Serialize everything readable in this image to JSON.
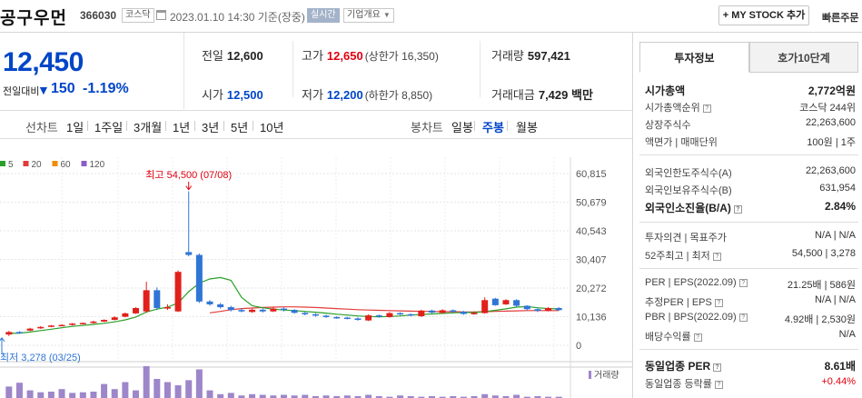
{
  "header": {
    "stock_name": "공구우먼",
    "stock_code": "366030",
    "market": "코스닥",
    "datetime": "2023.01.10 14:30 기준(장중)",
    "realtime": "실시간",
    "company_overview": "기업개요",
    "mystock_button": "+ MY STOCK 추가",
    "quick_order": "빠른주문"
  },
  "price": {
    "current": "12,450",
    "change_label": "전일대비",
    "change_amount": "150",
    "change_rate": "-1.19%"
  },
  "stats": {
    "prev_close_label": "전일",
    "prev_close": "12,600",
    "high_label": "고가",
    "high": "12,650",
    "upper_limit": "(상한가 16,350)",
    "volume_label": "거래량",
    "volume": "597,421",
    "open_label": "시가",
    "open": "12,500",
    "low_label": "저가",
    "low": "12,200",
    "lower_limit": "(하한가 8,850)",
    "amount_label": "거래대금",
    "amount": "7,429 백만"
  },
  "tabs": {
    "line_chart": "선차트",
    "periods": [
      "1일",
      "1주일",
      "3개월",
      "1년",
      "3년",
      "5년",
      "10년"
    ],
    "candle_chart": "봉차트",
    "candle_types": [
      "일봉",
      "주봉",
      "월봉"
    ],
    "active_candle": "주봉"
  },
  "chart_data": {
    "type": "candlestick",
    "legend": [
      {
        "name": "5",
        "color": "#2aa02a"
      },
      {
        "name": "20",
        "color": "#e23b3b"
      },
      {
        "name": "60",
        "color": "#f28c00"
      },
      {
        "name": "120",
        "color": "#8a5cc7"
      }
    ],
    "y_ticks": [
      "60,815",
      "50,679",
      "40,543",
      "30,407",
      "20,272",
      "10,136",
      "0"
    ],
    "ylim": [
      0,
      60815
    ],
    "high_annotation": "최고 54,500 (07/08)",
    "low_annotation": "최저 3,278 (03/25)",
    "volume_label": "거래량",
    "candles": [
      {
        "o": 3800,
        "c": 4700,
        "h": 5100,
        "l": 3278
      },
      {
        "o": 4700,
        "c": 4300,
        "h": 5000,
        "l": 4100
      },
      {
        "o": 5200,
        "c": 5900,
        "h": 6200,
        "l": 5000
      },
      {
        "o": 6000,
        "c": 6500,
        "h": 6800,
        "l": 5800
      },
      {
        "o": 6600,
        "c": 7000,
        "h": 7200,
        "l": 6400
      },
      {
        "o": 7000,
        "c": 7200,
        "h": 7500,
        "l": 6800
      },
      {
        "o": 7200,
        "c": 7700,
        "h": 7900,
        "l": 7000
      },
      {
        "o": 7700,
        "c": 7900,
        "h": 8100,
        "l": 7500
      },
      {
        "o": 7900,
        "c": 8400,
        "h": 8700,
        "l": 7700
      },
      {
        "o": 8400,
        "c": 9000,
        "h": 9200,
        "l": 8200
      },
      {
        "o": 9000,
        "c": 9900,
        "h": 10300,
        "l": 8800
      },
      {
        "o": 10100,
        "c": 11300,
        "h": 11600,
        "l": 9900
      },
      {
        "o": 11300,
        "c": 13200,
        "h": 13500,
        "l": 11100
      },
      {
        "o": 12000,
        "c": 19500,
        "h": 22500,
        "l": 11500
      },
      {
        "o": 19500,
        "c": 13200,
        "h": 20500,
        "l": 12500
      },
      {
        "o": 13000,
        "c": 13500,
        "h": 14500,
        "l": 12500
      },
      {
        "o": 12000,
        "c": 26000,
        "h": 26500,
        "l": 11800
      },
      {
        "o": 33000,
        "c": 32000,
        "h": 54500,
        "l": 31500
      },
      {
        "o": 32000,
        "c": 15500,
        "h": 32500,
        "l": 15000
      },
      {
        "o": 15500,
        "c": 14500,
        "h": 16000,
        "l": 14000
      },
      {
        "o": 14500,
        "c": 13500,
        "h": 15000,
        "l": 13000
      },
      {
        "o": 13500,
        "c": 12500,
        "h": 14000,
        "l": 12000
      },
      {
        "o": 12500,
        "c": 12000,
        "h": 13200,
        "l": 11700
      },
      {
        "o": 11800,
        "c": 12600,
        "h": 13000,
        "l": 11500
      },
      {
        "o": 12600,
        "c": 12000,
        "h": 13100,
        "l": 11600
      },
      {
        "o": 12000,
        "c": 13000,
        "h": 13500,
        "l": 11800
      },
      {
        "o": 13000,
        "c": 12500,
        "h": 13400,
        "l": 12000
      },
      {
        "o": 12500,
        "c": 11500,
        "h": 12800,
        "l": 11200
      },
      {
        "o": 11500,
        "c": 11000,
        "h": 11800,
        "l": 10600
      },
      {
        "o": 11000,
        "c": 10500,
        "h": 11300,
        "l": 10100
      },
      {
        "o": 10500,
        "c": 10000,
        "h": 10800,
        "l": 9700
      },
      {
        "o": 10000,
        "c": 9800,
        "h": 10300,
        "l": 9400
      },
      {
        "o": 9800,
        "c": 9500,
        "h": 10100,
        "l": 9200
      },
      {
        "o": 9500,
        "c": 9000,
        "h": 9900,
        "l": 8700
      },
      {
        "o": 8800,
        "c": 10600,
        "h": 11000,
        "l": 8600
      },
      {
        "o": 10600,
        "c": 10100,
        "h": 10900,
        "l": 9800
      },
      {
        "o": 10000,
        "c": 11400,
        "h": 11800,
        "l": 9800
      },
      {
        "o": 11400,
        "c": 11000,
        "h": 11700,
        "l": 10700
      },
      {
        "o": 11000,
        "c": 10600,
        "h": 11300,
        "l": 10300
      },
      {
        "o": 10300,
        "c": 12300,
        "h": 12600,
        "l": 10000
      },
      {
        "o": 12300,
        "c": 11600,
        "h": 12600,
        "l": 11200
      },
      {
        "o": 11500,
        "c": 12400,
        "h": 12800,
        "l": 11100
      },
      {
        "o": 12400,
        "c": 11900,
        "h": 12700,
        "l": 11600
      },
      {
        "o": 11900,
        "c": 11100,
        "h": 12200,
        "l": 10800
      },
      {
        "o": 11000,
        "c": 11500,
        "h": 12000,
        "l": 10800
      },
      {
        "o": 11400,
        "c": 16000,
        "h": 17000,
        "l": 11200
      },
      {
        "o": 16500,
        "c": 14200,
        "h": 16800,
        "l": 14000
      },
      {
        "o": 14500,
        "c": 16000,
        "h": 16300,
        "l": 14300
      },
      {
        "o": 16000,
        "c": 14000,
        "h": 16300,
        "l": 13600
      },
      {
        "o": 14000,
        "c": 12800,
        "h": 14200,
        "l": 12400
      },
      {
        "o": 12800,
        "c": 12200,
        "h": 13100,
        "l": 11800
      },
      {
        "o": 12200,
        "c": 13200,
        "h": 13500,
        "l": 12000
      },
      {
        "o": 13200,
        "c": 12450,
        "h": 13500,
        "l": 12200
      }
    ],
    "ma5": [
      4200,
      4300,
      4700,
      5200,
      5700,
      6200,
      6700,
      7000,
      7400,
      7800,
      8300,
      9000,
      10000,
      11800,
      12800,
      13500,
      15000,
      19000,
      22000,
      23500,
      24000,
      23000,
      17000,
      14000,
      13300,
      12800,
      12500,
      12300,
      12000,
      11700,
      11400,
      11000,
      10700,
      10400,
      10200,
      10100,
      10200,
      10400,
      10700,
      10900,
      11100,
      11300,
      11500,
      11600,
      11600,
      11900,
      12400,
      12900,
      13500,
      13700,
      13300,
      13000,
      12900
    ],
    "ma20": [
      null,
      null,
      null,
      null,
      null,
      null,
      null,
      null,
      null,
      null,
      null,
      null,
      null,
      null,
      null,
      null,
      null,
      null,
      null,
      11500,
      12000,
      12600,
      13000,
      13200,
      13400,
      13500,
      13600,
      13600,
      13500,
      13400,
      13200,
      13000,
      12800,
      12600,
      12500,
      12400,
      12300,
      12200,
      12100,
      12000,
      12000,
      11900,
      11900,
      11800,
      11800,
      11900,
      12000,
      12100,
      12200,
      12300,
      12300,
      12300,
      12300
    ],
    "volumes": [
      18,
      24,
      12,
      9,
      10,
      14,
      8,
      9,
      10,
      22,
      14,
      25,
      12,
      50,
      30,
      25,
      20,
      28,
      45,
      12,
      6,
      8,
      4,
      6,
      5,
      4,
      5,
      4,
      5,
      3,
      4,
      3,
      4,
      3,
      5,
      3,
      2,
      4,
      3,
      2,
      3,
      2,
      3,
      2,
      3,
      6,
      4,
      3,
      5,
      2,
      3,
      2,
      2
    ]
  },
  "info_panel": {
    "tab_info": "투자정보",
    "tab_ask": "호가10단계",
    "rows1": [
      {
        "k": "시가총액",
        "v": "2,772억원",
        "bold": true
      },
      {
        "k": "시가총액순위",
        "v": "코스닥 244위",
        "q": true
      },
      {
        "k": "상장주식수",
        "v": "22,263,600"
      },
      {
        "k": "액면가 | 매매단위",
        "v": "100원 | 1주"
      }
    ],
    "rows2": [
      {
        "k": "외국인한도주식수(A)",
        "v": "22,263,600"
      },
      {
        "k": "외국인보유주식수(B)",
        "v": "631,954"
      },
      {
        "k": "외국인소진율(B/A)",
        "v": "2.84%",
        "bold": true,
        "q": true
      }
    ],
    "rows3": [
      {
        "k": "투자의견 | 목표주가",
        "v": "N/A | N/A"
      },
      {
        "k": "52주최고 | 최저",
        "v": "54,500 | 3,278",
        "q": true
      }
    ],
    "rows4": [
      {
        "k": "PER | EPS(2022.09)",
        "v": "21.25배 | 586원",
        "q": true
      },
      {
        "k": "추정PER | EPS",
        "v": "N/A | N/A",
        "q": true
      },
      {
        "k": "PBR | BPS(2022.09)",
        "v": "4.92배 | 2,530원",
        "q": true
      },
      {
        "k": "배당수익률",
        "v": "N/A",
        "q": true
      }
    ],
    "rows5": [
      {
        "k": "동일업종 PER",
        "v": "8.61배",
        "bold": true,
        "q": true
      },
      {
        "k": "동일업종 등락률",
        "v": "+0.44%",
        "q": true,
        "red": true
      }
    ]
  }
}
